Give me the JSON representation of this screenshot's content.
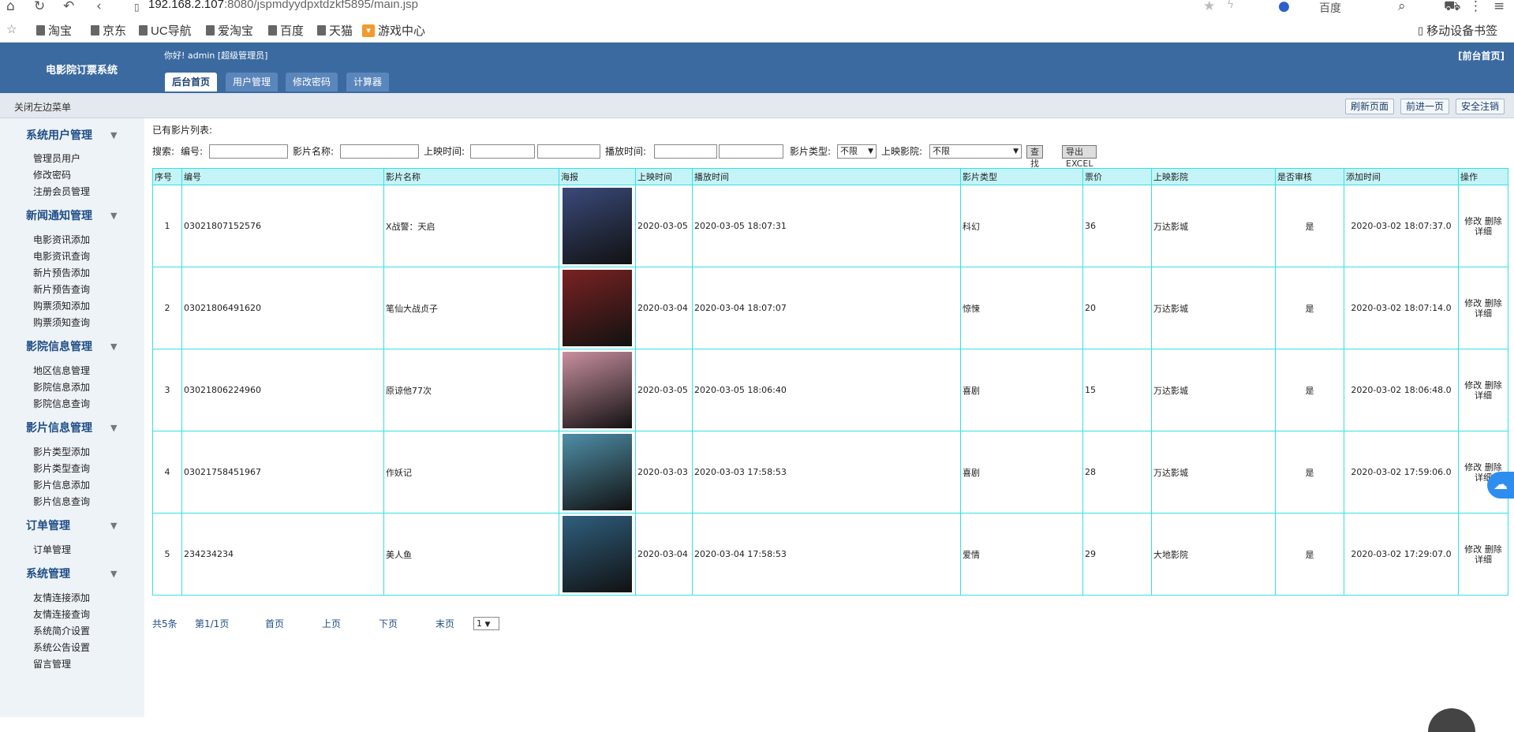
{
  "browser": {
    "url_host": "192.168.2.107",
    "url_path": ":8080/jspmdyydpxtdzkf5895/main.jsp",
    "search_engine": "百度",
    "bookmarks": [
      "淘宝",
      "京东",
      "UC导航",
      "爱淘宝",
      "百度",
      "天猫",
      "游戏中心"
    ],
    "mobile_bookmarks": "移动设备书签"
  },
  "header": {
    "app_title": "电影院订票系统",
    "greeting": "你好! admin [超级管理员]",
    "front_home": "[前台首页]",
    "tabs": [
      "后台首页",
      "用户管理",
      "修改密码",
      "计算器"
    ]
  },
  "subbar": {
    "close_menu": "关闭左边菜单",
    "refresh": "刷新页面",
    "back": "前进一页",
    "logout": "安全注销"
  },
  "sidebar": [
    {
      "title": "系统用户管理",
      "items": [
        "管理员用户",
        "修改密码",
        "注册会员管理"
      ]
    },
    {
      "title": "新闻通知管理",
      "items": [
        "电影资讯添加",
        "电影资讯查询",
        "新片预告添加",
        "新片预告查询",
        "购票须知添加",
        "购票须知查询"
      ]
    },
    {
      "title": "影院信息管理",
      "items": [
        "地区信息管理",
        "影院信息添加",
        "影院信息查询"
      ]
    },
    {
      "title": "影片信息管理",
      "items": [
        "影片类型添加",
        "影片类型查询",
        "影片信息添加",
        "影片信息查询"
      ]
    },
    {
      "title": "订单管理",
      "items": [
        "订单管理"
      ]
    },
    {
      "title": "系统管理",
      "items": [
        "友情连接添加",
        "友情连接查询",
        "系统简介设置",
        "系统公告设置",
        "留言管理"
      ]
    }
  ],
  "content": {
    "list_label": "已有影片列表:",
    "search": {
      "label": "搜索:",
      "code_label": "编号:",
      "name_label": "影片名称:",
      "release_label": "上映时间:",
      "play_label": "播放时间:",
      "type_label": "影片类型:",
      "type_value": "不限",
      "cinema_label": "上映影院:",
      "cinema_value": "不限",
      "find_button": "查找",
      "export_button": "导出EXCEL"
    },
    "table": {
      "headers": [
        "序号",
        "编号",
        "影片名称",
        "海报",
        "上映时间",
        "播放时间",
        "影片类型",
        "票价",
        "上映影院",
        "是否审核",
        "添加时间",
        "操作"
      ],
      "rows": [
        {
          "no": "1",
          "code": "03021807152576",
          "name": "X战警：天启",
          "release": "2020-03-05",
          "play": "2020-03-05 18:07:31",
          "type": "科幻",
          "price": "36",
          "cinema": "万达影城",
          "audited": "是",
          "added": "2020-03-02 18:07:37.0",
          "poster_color": "#3a4a7a"
        },
        {
          "no": "2",
          "code": "03021806491620",
          "name": "笔仙大战贞子",
          "release": "2020-03-04",
          "play": "2020-03-04 18:07:07",
          "type": "惊悚",
          "price": "20",
          "cinema": "万达影城",
          "audited": "是",
          "added": "2020-03-02 18:07:14.0",
          "poster_color": "#7a2222"
        },
        {
          "no": "3",
          "code": "03021806224960",
          "name": "原谅他77次",
          "release": "2020-03-05",
          "play": "2020-03-05 18:06:40",
          "type": "喜剧",
          "price": "15",
          "cinema": "万达影城",
          "audited": "是",
          "added": "2020-03-02 18:06:48.0",
          "poster_color": "#c98fa0"
        },
        {
          "no": "4",
          "code": "03021758451967",
          "name": "作妖记",
          "release": "2020-03-03",
          "play": "2020-03-03 17:58:53",
          "type": "喜剧",
          "price": "28",
          "cinema": "万达影城",
          "audited": "是",
          "added": "2020-03-02 17:59:06.0",
          "poster_color": "#4f8fa8"
        },
        {
          "no": "5",
          "code": "234234234",
          "name": "美人鱼",
          "release": "2020-03-04",
          "play": "2020-03-04 17:58:53",
          "type": "爱情",
          "price": "29",
          "cinema": "大地影院",
          "audited": "是",
          "added": "2020-03-02 17:29:07.0",
          "poster_color": "#2f5f7f"
        }
      ],
      "op_edit": "修改",
      "op_delete": "删除",
      "op_detail": "详细"
    },
    "pager": {
      "total": "共5条",
      "page_of": "第1/1页",
      "first": "首页",
      "prev": "上页",
      "next": "下页",
      "last": "末页",
      "select_value": "1"
    }
  }
}
